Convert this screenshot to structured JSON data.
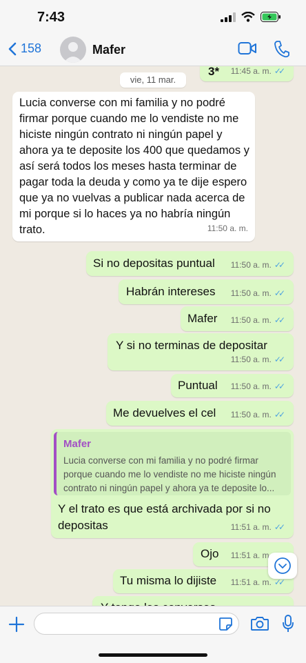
{
  "status_bar": {
    "time": "7:43",
    "battery_color": "#34c759"
  },
  "header": {
    "back_count": "158",
    "contact_name": "Mafer",
    "accent": "#1f74d8",
    "icons": [
      "chevron-left-icon",
      "avatar",
      "video-call-icon",
      "phone-icon"
    ]
  },
  "chat": {
    "date_chip": "vie, 11 mar.",
    "messages": [
      {
        "dir": "out",
        "text": "3*",
        "time": "11:45 a. m."
      },
      {
        "dir": "in",
        "text": "Lucia converse con mi familia y no podré firmar porque cuando me lo vendiste no me hiciste ningún contrato ni ningún papel y ahora ya te deposite los 400 que quedamos y así será todos los meses hasta terminar de pagar toda la deuda y como ya te dije espero que ya no vuelvas a publicar nada acerca de mi porque si lo haces ya no habría ningún trato.",
        "time": "11:50 a. m."
      },
      {
        "dir": "out",
        "text": "Si no depositas puntual",
        "time": "11:50 a. m."
      },
      {
        "dir": "out",
        "text": "Habrán intereses",
        "time": "11:50 a. m."
      },
      {
        "dir": "out",
        "text": "Mafer",
        "time": "11:50 a. m."
      },
      {
        "dir": "out",
        "text": "Y si no terminas de depositar",
        "time": "11:50 a. m."
      },
      {
        "dir": "out",
        "text": "Puntual",
        "time": "11:50 a. m."
      },
      {
        "dir": "out",
        "text": "Me devuelves el cel",
        "time": "11:50 a. m."
      },
      {
        "dir": "out",
        "quote_name": "Mafer",
        "quote_text": "Lucia converse con mi familia y no podré firmar porque cuando me lo vendiste no me hiciste ningún contrato ni ningún papel y ahora ya te deposite lo...",
        "text": "Y el trato es que está archivada por si no depositas",
        "time": "11:51 a. m."
      },
      {
        "dir": "out",
        "text": "Ojo",
        "time": "11:51 a. m."
      },
      {
        "dir": "out",
        "text": "Tu misma lo dijiste",
        "time": "11:51 a. m."
      },
      {
        "dir": "out",
        "text": "Y tengo las conversas",
        "time": ""
      }
    ],
    "colors": {
      "outgoing": "#dcf8c6",
      "incoming": "#ffffff",
      "ticks": "#4fa3e0",
      "quote_author": "#a24fc4"
    }
  },
  "composer": {
    "placeholder": ""
  }
}
